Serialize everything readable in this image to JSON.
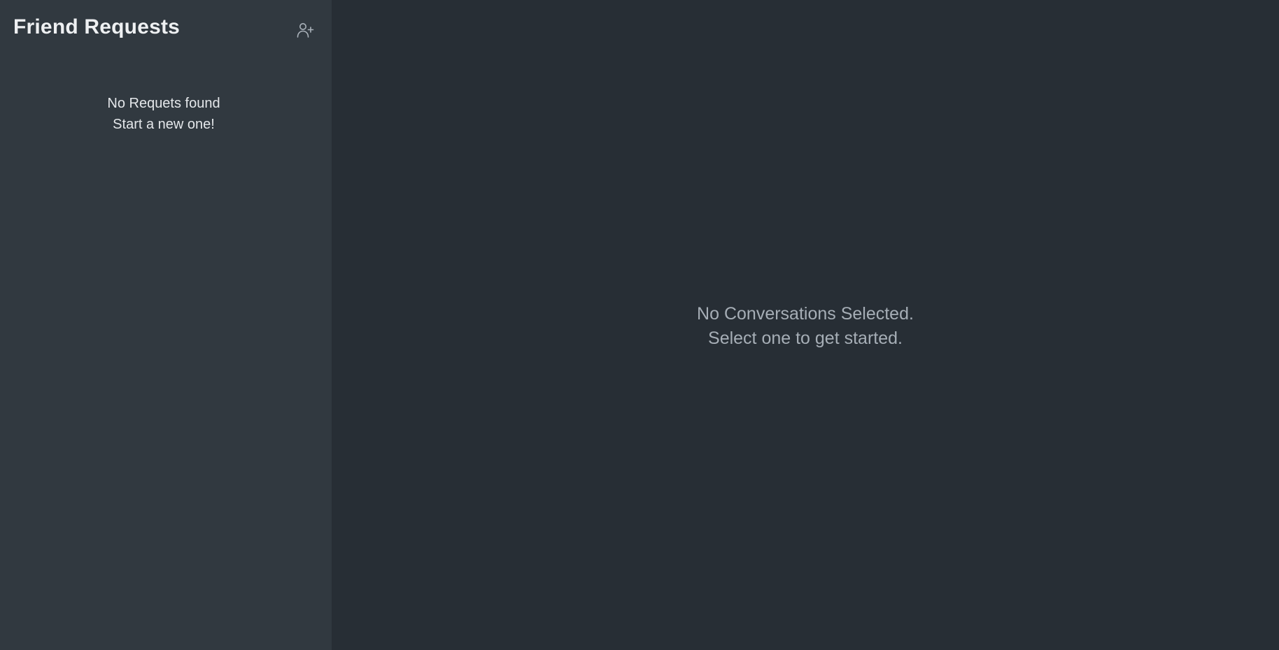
{
  "sidebar": {
    "title": "Friend Requests",
    "add_friend_icon": "user-plus-icon",
    "empty_state": {
      "line1": "No Requets found",
      "line2": "Start a new one!"
    }
  },
  "main": {
    "empty_state": {
      "line1": "No Conversations Selected.",
      "line2": "Select one to get started."
    }
  },
  "colors": {
    "sidebar_bg": "#313940",
    "main_bg": "#272e35",
    "title_text": "#eef0f2",
    "muted_text": "#a6aeb6",
    "icon": "#aab2ba"
  }
}
